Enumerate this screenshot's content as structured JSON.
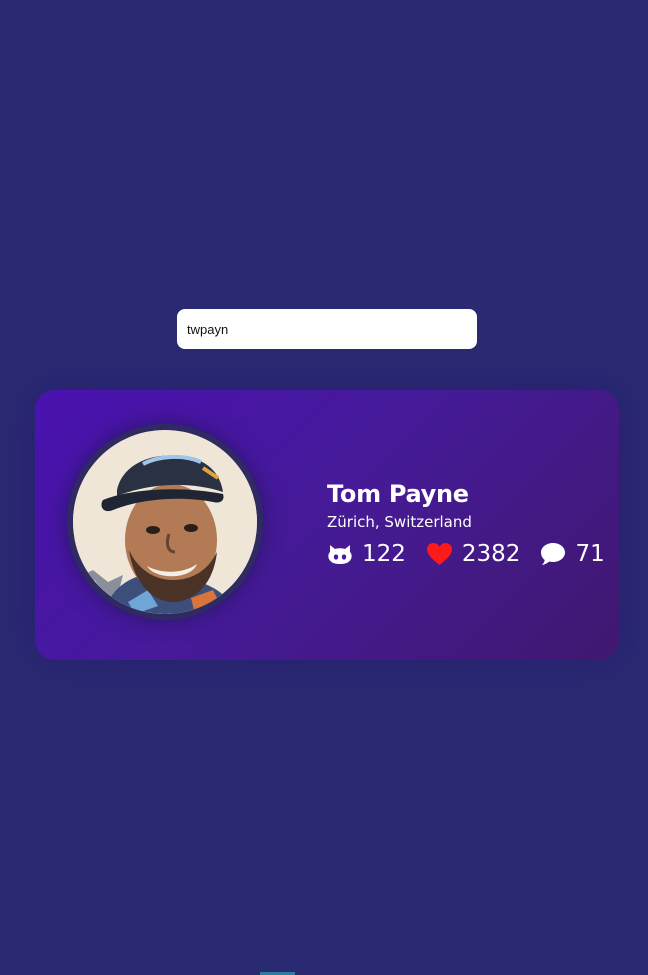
{
  "search": {
    "value": "twpayn",
    "placeholder": ""
  },
  "profile": {
    "name": "Tom Payne",
    "location": "Zürich, Switzerland",
    "avatar_icon": "profile-photo",
    "stats": {
      "repos": {
        "icon": "github-icon",
        "value": "122"
      },
      "followers": {
        "icon": "heart-icon",
        "value": "2382",
        "color": "#ff1a1a"
      },
      "comments": {
        "icon": "comment-icon",
        "value": "71"
      }
    }
  },
  "colors": {
    "background": "#2a2a72",
    "card_gradient_start": "#4a12b0",
    "card_gradient_end": "#40186f",
    "text": "#ffffff"
  }
}
